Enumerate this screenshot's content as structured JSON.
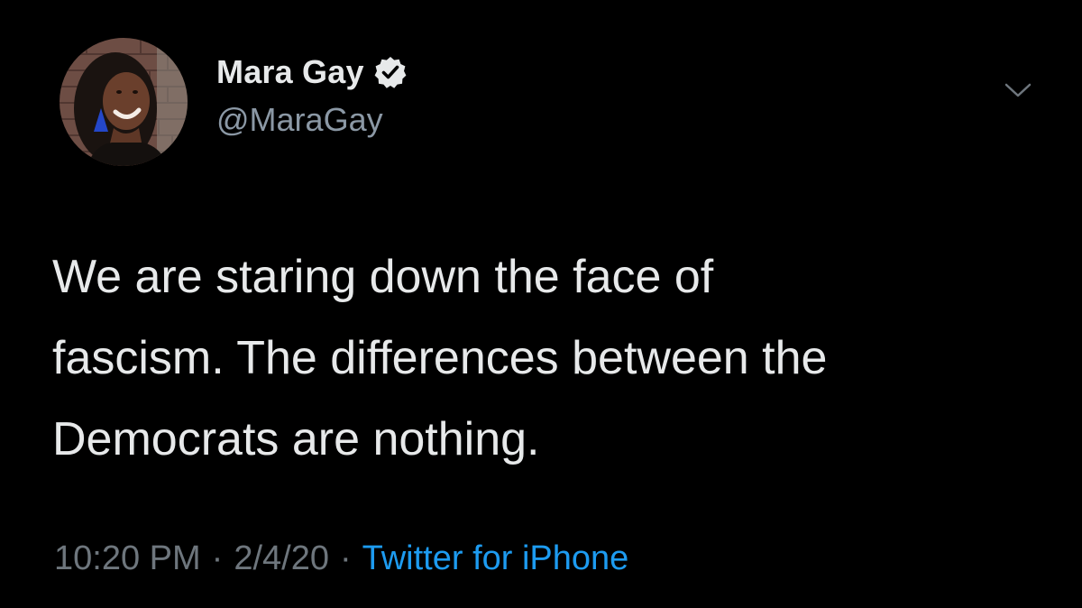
{
  "user": {
    "display_name": "Mara Gay",
    "handle": "@MaraGay",
    "verified": true
  },
  "tweet": {
    "text_lines": [
      "We are staring down the face of",
      "fascism. The differences between the",
      "Democrats are nothing."
    ],
    "time": "10:20 PM",
    "date": "2/4/20",
    "separator": "·",
    "source": "Twitter for iPhone"
  },
  "icons": {
    "verified": "verified-badge-icon",
    "menu": "chevron-down-icon"
  },
  "colors": {
    "background": "#000000",
    "primary_text": "#e7e9ea",
    "secondary_text": "#8b98a5",
    "meta_text": "#6e767d",
    "link": "#1d9bf0"
  }
}
